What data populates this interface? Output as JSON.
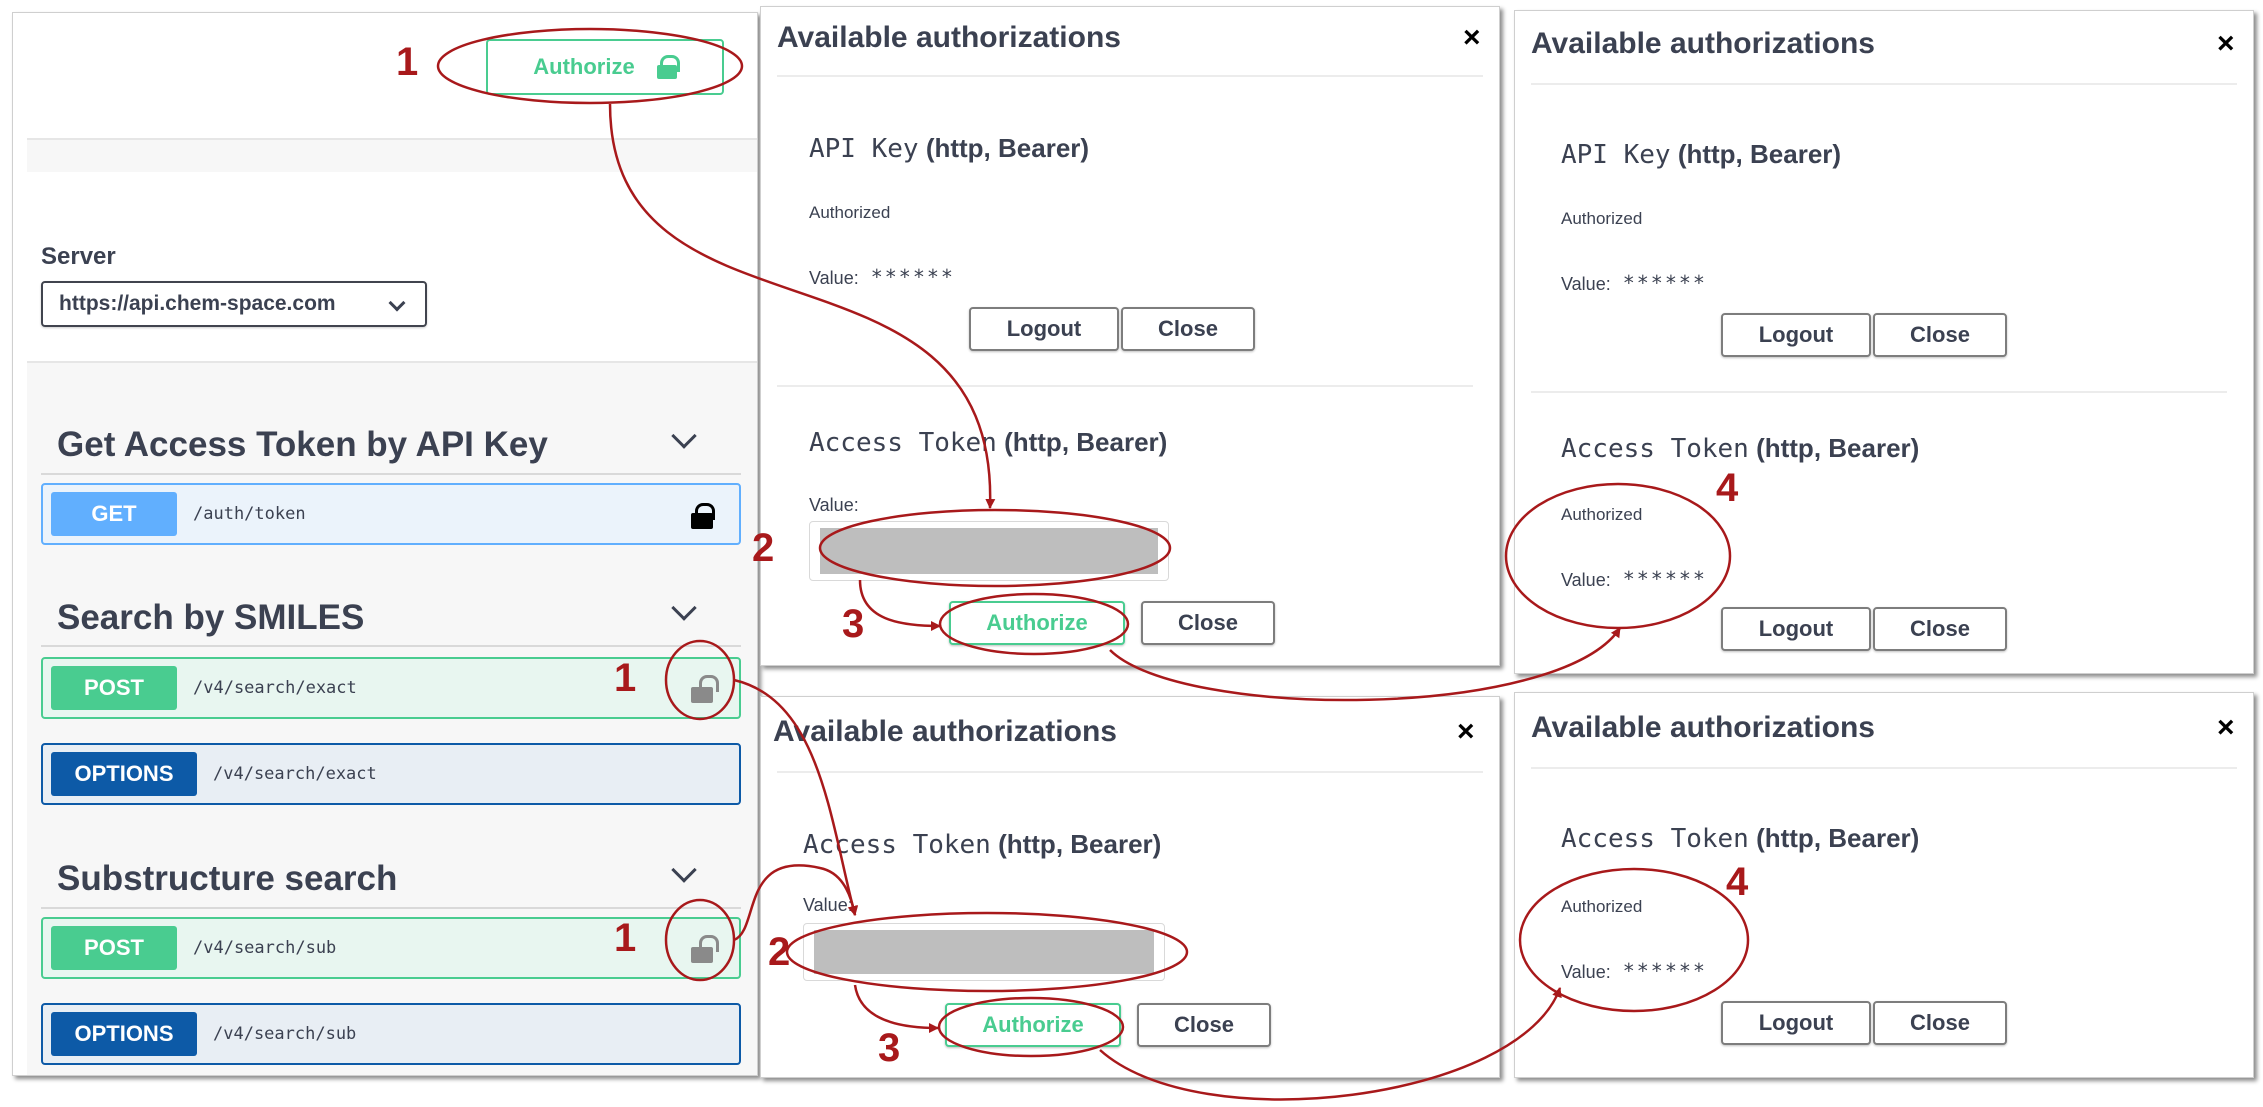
{
  "left": {
    "authorize_label": "Authorize",
    "server_label": "Server",
    "server_value": "https://api.chem-space.com",
    "groups": [
      {
        "title": "Get Access Token by API Key",
        "ops": [
          {
            "method": "GET",
            "path": "/auth/token"
          }
        ]
      },
      {
        "title": "Search by SMILES",
        "ops": [
          {
            "method": "POST",
            "path": "/v4/search/exact"
          },
          {
            "method": "OPTIONS",
            "path": "/v4/search/exact"
          }
        ]
      },
      {
        "title": "Substructure search",
        "ops": [
          {
            "method": "POST",
            "path": "/v4/search/sub"
          },
          {
            "method": "OPTIONS",
            "path": "/v4/search/sub"
          }
        ]
      }
    ]
  },
  "dialogs": {
    "title": "Available authorizations",
    "close_glyph": "×",
    "api_key_scheme_mono": "API Key",
    "access_token_scheme_mono": "Access Token",
    "scheme_type": "(http, Bearer)",
    "authorized_text": "Authorized",
    "value_label": "Value:",
    "masked_value": "******",
    "logout_label": "Logout",
    "close_label": "Close",
    "authorize_label": "Authorize"
  },
  "annotations": {
    "step1": "1",
    "step2": "2",
    "step3": "3",
    "step4": "4",
    "color": "#a8191b"
  }
}
